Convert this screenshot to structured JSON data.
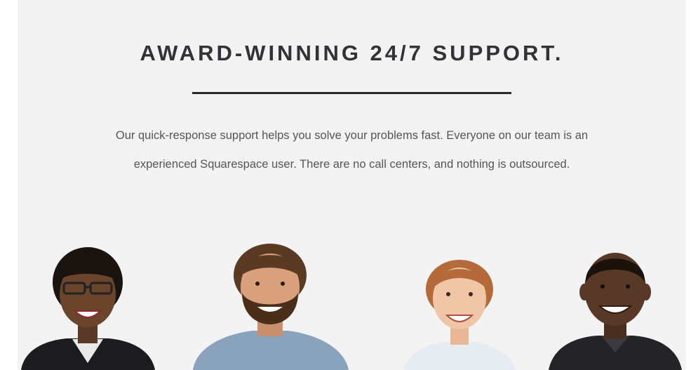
{
  "support": {
    "title": "AWARD-WINNING 24/7 SUPPORT.",
    "description_line1": "Our quick-response support helps you solve your problems fast. Everyone on our team is an",
    "description_line2": "experienced Squarespace user. There are no call centers, and nothing is outsourced."
  },
  "team_photos": [
    {
      "icon": "woman-with-glasses-photo"
    },
    {
      "icon": "bearded-man-photo"
    },
    {
      "icon": "red-haired-woman-photo"
    },
    {
      "icon": "smiling-man-photo"
    }
  ],
  "colors": {
    "background": "#f3f3f3",
    "title": "#333335",
    "body_text": "#555557",
    "divider": "#2a2a2a"
  }
}
